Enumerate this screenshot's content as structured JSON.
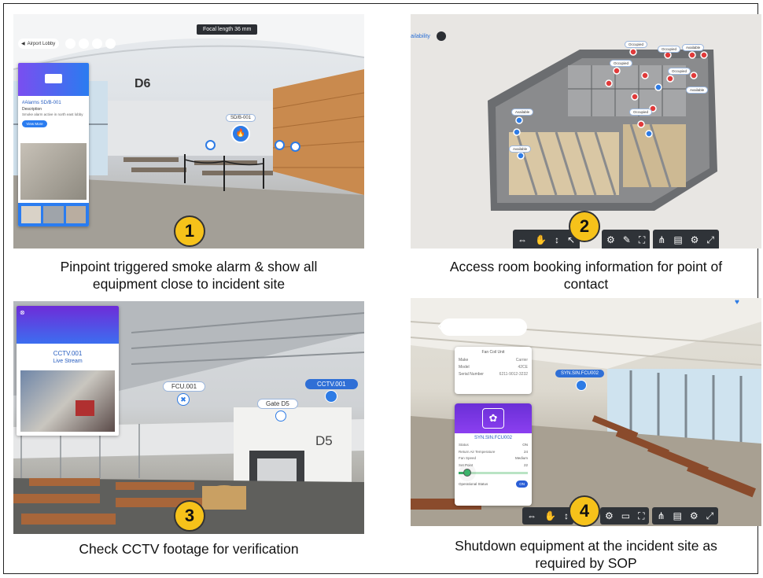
{
  "panels": [
    {
      "number": "1",
      "caption_line1": "Pinpoint triggered smoke alarm & show all",
      "caption_line2": "equipment close to incident site",
      "focal_label": "Focal length  36 mm",
      "back_label": "Airport Lobby",
      "gate_label": "D6",
      "pin_label": "SD/B-001",
      "card_title": "#Alarms SD/B-001",
      "card_desc": "Description",
      "card_desc_text": "Smoke alarm active in north east lobby",
      "card_button": "View More"
    },
    {
      "number": "2",
      "caption_line1": "Access room booking information for point of",
      "caption_line2": "contact",
      "availability_label": "ailability",
      "room_tags": [
        "Occupied",
        "Occupied",
        "Available",
        "Occupied",
        "Occupied",
        "Available",
        "Occupied",
        "Available",
        "Available"
      ]
    },
    {
      "number": "3",
      "caption_line1": "Check CCTV footage for verification",
      "card_title": "CCTV.001",
      "card_subtitle": "Live Stream",
      "tag_fcu": "FCU.001",
      "tag_gate": "Gate D5",
      "tag_cctv": "CCTV.001",
      "gate_label": "D5"
    },
    {
      "number": "4",
      "caption_line1": "Shutdown equipment at the incident site as",
      "caption_line2": "required by SOP",
      "unit_card_title": "Fan Coil Unit",
      "unit_rows": [
        {
          "k": "Make",
          "v": "Carrier"
        },
        {
          "k": "Model",
          "v": "42CE"
        },
        {
          "k": "Serial Number",
          "v": "6211-9012-3232"
        }
      ],
      "pin_label": "SYN.SIN.FCU002",
      "control_title": "SYN.SIN.FCU002",
      "control_rows": [
        {
          "k": "Status",
          "v": "ON"
        },
        {
          "k": "Return Air Temperature",
          "v": "24"
        },
        {
          "k": "Fan Speed",
          "v": "Medium"
        },
        {
          "k": "Set Point",
          "v": "22"
        }
      ],
      "operational_label": "Operational Status",
      "toggle_label": "ON"
    }
  ],
  "colors": {
    "badge": "#f6c21a",
    "accent_blue": "#2d7be5",
    "card_purple": "#6a2fd6",
    "toolbar": "#2f3338"
  }
}
